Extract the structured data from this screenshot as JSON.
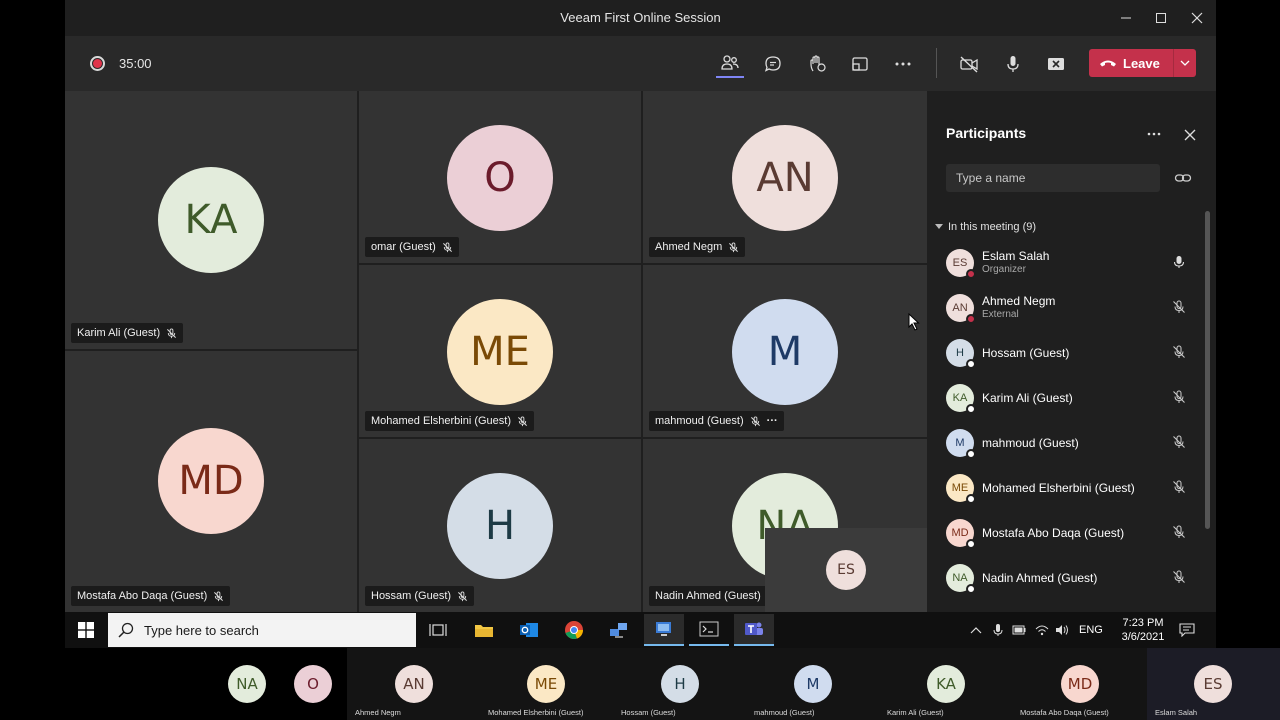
{
  "window": {
    "title": "Veeam First Online Session"
  },
  "toolbar": {
    "timer": "35:00",
    "leave_label": "Leave"
  },
  "tiles": [
    {
      "name": "Karim Ali (Guest)",
      "initials": "KA",
      "bg": "#e3ecdc",
      "fg": "#3f5b2a",
      "muted": true,
      "more": false
    },
    {
      "name": "omar (Guest)",
      "initials": "O",
      "bg": "#ebcfd6",
      "fg": "#6b1b2b",
      "muted": true,
      "more": false
    },
    {
      "name": "Ahmed Negm",
      "initials": "AN",
      "bg": "#efdfdc",
      "fg": "#5a3b33",
      "muted": true,
      "more": false
    },
    {
      "name": "Mohamed Elsherbini (Guest)",
      "initials": "ME",
      "bg": "#fbe8c5",
      "fg": "#7a4a06",
      "muted": true,
      "more": false
    },
    {
      "name": "mahmoud (Guest)",
      "initials": "M",
      "bg": "#d0dcef",
      "fg": "#1e3a66",
      "muted": true,
      "more": true
    },
    {
      "name": "Mostafa Abo Daqa (Guest)",
      "initials": "MD",
      "bg": "#f8d7cf",
      "fg": "#7a2a18",
      "muted": true,
      "more": false
    },
    {
      "name": "Hossam (Guest)",
      "initials": "H",
      "bg": "#d4dde7",
      "fg": "#1d3a45",
      "muted": true,
      "more": false
    },
    {
      "name": "Nadin Ahmed (Guest)",
      "initials": "NA",
      "bg": "#e3ecdc",
      "fg": "#3f5b2a",
      "muted": false,
      "more": false
    }
  ],
  "self_view": {
    "initials": "ES",
    "bg": "#efdfdc",
    "fg": "#5a3b33"
  },
  "participants": {
    "title": "Participants",
    "search_placeholder": "Type a name",
    "section_label": "In this meeting (9)",
    "items": [
      {
        "name": "Eslam Salah",
        "role": "Organizer",
        "initials": "ES",
        "bg": "#efdfdc",
        "fg": "#5a3b33",
        "status": "busy",
        "mic": "on"
      },
      {
        "name": "Ahmed Negm",
        "role": "External",
        "initials": "AN",
        "bg": "#efdfdc",
        "fg": "#5a3b33",
        "status": "busy",
        "mic": "off"
      },
      {
        "name": "Hossam (Guest)",
        "role": "",
        "initials": "H",
        "bg": "#d4dde7",
        "fg": "#1d3a45",
        "status": "guest",
        "mic": "off"
      },
      {
        "name": "Karim Ali (Guest)",
        "role": "",
        "initials": "KA",
        "bg": "#e3ecdc",
        "fg": "#3f5b2a",
        "status": "guest",
        "mic": "off"
      },
      {
        "name": "mahmoud (Guest)",
        "role": "",
        "initials": "M",
        "bg": "#d0dcef",
        "fg": "#1e3a66",
        "status": "guest",
        "mic": "off"
      },
      {
        "name": "Mohamed Elsherbini (Guest)",
        "role": "",
        "initials": "ME",
        "bg": "#fbe8c5",
        "fg": "#7a4a06",
        "status": "guest",
        "mic": "off"
      },
      {
        "name": "Mostafa Abo Daqa (Guest)",
        "role": "",
        "initials": "MD",
        "bg": "#f8d7cf",
        "fg": "#7a2a18",
        "status": "guest",
        "mic": "off"
      },
      {
        "name": "Nadin Ahmed (Guest)",
        "role": "",
        "initials": "NA",
        "bg": "#e3ecdc",
        "fg": "#3f5b2a",
        "status": "guest",
        "mic": "off"
      }
    ]
  },
  "taskbar": {
    "search_placeholder": "Type here to search",
    "language": "ENG",
    "time": "7:23 PM",
    "date": "3/6/2021"
  },
  "bottom_strip": [
    {
      "initials": "NA",
      "label": "",
      "bg": "#e3ecdc",
      "fg": "#3f5b2a"
    },
    {
      "initials": "O",
      "label": "",
      "bg": "#ebcfd6",
      "fg": "#6b1b2b"
    },
    {
      "initials": "AN",
      "label": "Ahmed  Negm",
      "bg": "#efdfdc",
      "fg": "#5a3b33"
    },
    {
      "initials": "ME",
      "label": "Mohamed Elsherbini (Guest)",
      "bg": "#fbe8c5",
      "fg": "#7a4a06"
    },
    {
      "initials": "H",
      "label": "Hossam (Guest)",
      "bg": "#d4dde7",
      "fg": "#1d3a45"
    },
    {
      "initials": "M",
      "label": "mahmoud (Guest)",
      "bg": "#d0dcef",
      "fg": "#1e3a66"
    },
    {
      "initials": "KA",
      "label": "Karim Ali (Guest)",
      "bg": "#e3ecdc",
      "fg": "#3f5b2a"
    },
    {
      "initials": "MD",
      "label": "Mostafa Abo Daqa (Guest)",
      "bg": "#f8d7cf",
      "fg": "#7a2a18"
    },
    {
      "initials": "ES",
      "label": "Eslam Salah",
      "bg": "#efdfdc",
      "fg": "#5a3b33"
    }
  ]
}
